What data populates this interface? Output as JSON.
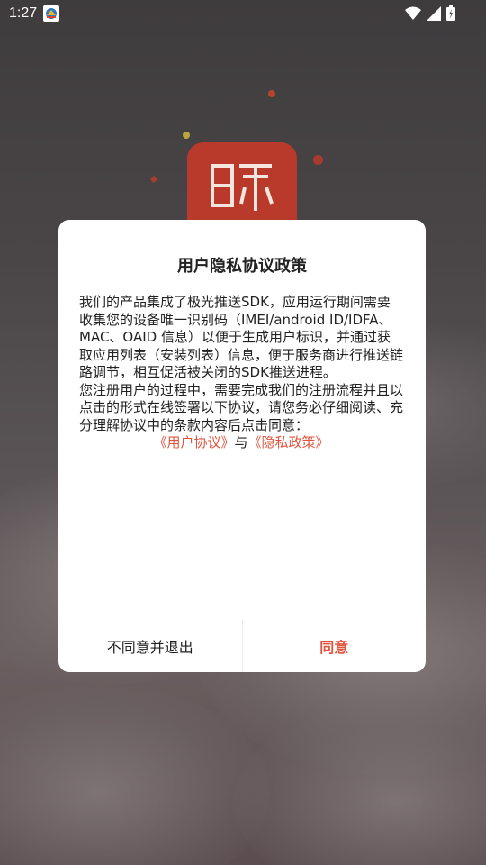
{
  "status_bar": {
    "time": "1:27",
    "icons": [
      "app-notification-icon",
      "wifi-icon",
      "signal-icon",
      "battery-icon"
    ]
  },
  "splash": {
    "logo_icon": "app-logo-icon"
  },
  "dialog": {
    "title": "用户隐私协议政策",
    "paragraph_1": "我们的产品集成了极光推送SDK，应用运行期间需要收集您的设备唯一识别码（IMEI/android ID/IDFA、MAC、OAID 信息）以便于生成用户标识，并通过获取应用列表（安装列表）信息，便于服务商进行推送链路调节，相互促活被关闭的SDK推送进程。",
    "paragraph_2": "您注册用户的过程中，需要完成我们的注册流程并且以点击的形式在线签署以下协议，请您务必仔细阅读、充分理解协议中的条款内容后点击同意：",
    "user_agreement_link": "《用户协议》",
    "link_separator": "与",
    "privacy_policy_link": "《隐私政策》",
    "disagree_button": "不同意并退出",
    "agree_button": "同意"
  },
  "colors": {
    "accent": "#e0543e",
    "logo_red": "#b93a2a",
    "text": "#222222"
  }
}
